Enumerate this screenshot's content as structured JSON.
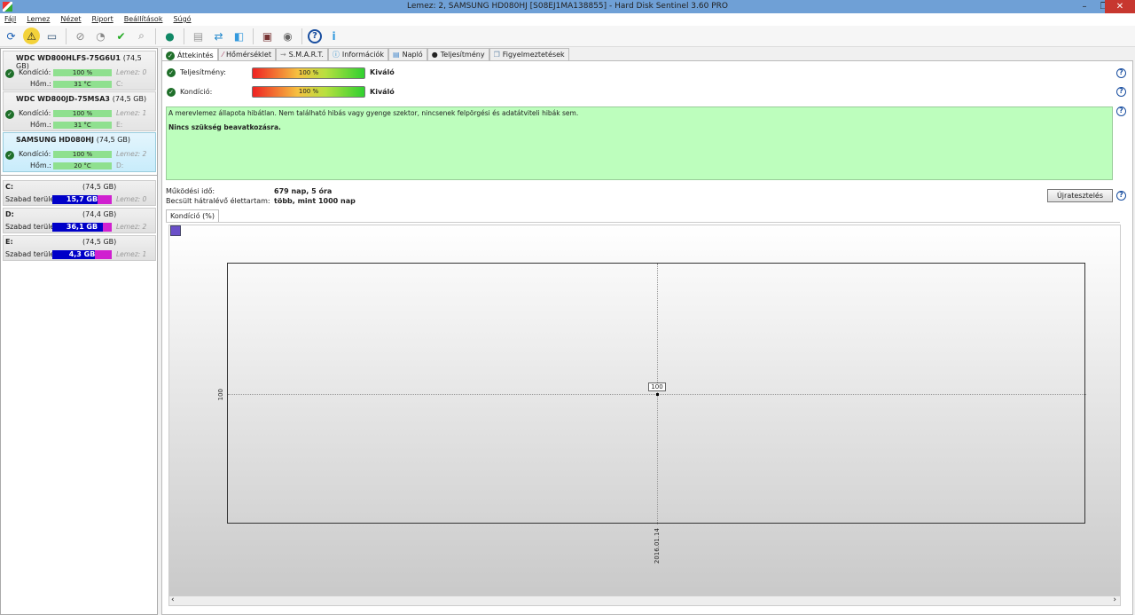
{
  "window": {
    "title": "Lemez: 2, SAMSUNG HD080HJ [S08EJ1MA138855]  -  Hard Disk Sentinel 3.60 PRO",
    "minimize": "–",
    "restore": "❐",
    "close": "✕"
  },
  "menu": [
    "Fájl",
    "Lemez",
    "Nézet",
    "Riport",
    "Beállítások",
    "Súgó"
  ],
  "toolbar_icons": [
    "refresh-icon",
    "alert-icon",
    "disk-info-icon",
    "test-icon",
    "test-timer-icon",
    "test-ok-icon",
    "test-search-icon",
    "web-icon",
    "report-icon",
    "sync-icon",
    "network-icon",
    "edit-icon",
    "sound-icon",
    "help-icon",
    "info-icon"
  ],
  "disks": [
    {
      "name": "WDC WD800HLFS-75G6U1",
      "size": "(74,5 GB)",
      "cond_label": "Kondíció:",
      "cond": "100 %",
      "temp_label": "Hőm.:",
      "temp": "31 °C",
      "lemez": "Lemez: 0",
      "drive": "C:"
    },
    {
      "name": "WDC WD800JD-75MSA3",
      "size": "(74,5 GB)",
      "cond_label": "Kondíció:",
      "cond": "100 %",
      "temp_label": "Hőm.:",
      "temp": "31 °C",
      "lemez": "Lemez: 1",
      "drive": "E:"
    },
    {
      "name": "SAMSUNG HD080HJ",
      "size": "(74,5 GB)",
      "cond_label": "Kondíció:",
      "cond": "100 %",
      "temp_label": "Hőm.:",
      "temp": "20 °C",
      "lemez": "Lemez: 2",
      "drive": "D:",
      "selected": true
    }
  ],
  "volumes": [
    {
      "letter": "C:",
      "size": "(74,5 GB)",
      "free_label": "Szabad terület",
      "free": "15,7 GB",
      "free_pct": 21,
      "lemez": "Lemez: 0"
    },
    {
      "letter": "D:",
      "size": "(74,4 GB)",
      "free_label": "Szabad terület",
      "free": "36,1 GB",
      "free_pct": 49,
      "lemez": "Lemez: 2"
    },
    {
      "letter": "E:",
      "size": "(74,5 GB)",
      "free_label": "Szabad terület",
      "free": "4,3 GB",
      "free_pct": 6,
      "lemez": "Lemez: 1"
    }
  ],
  "tabs": [
    "Áttekintés",
    "Hőmérséklet",
    "S.M.A.R.T.",
    "Információk",
    "Napló",
    "Teljesítmény",
    "Figyelmeztetések"
  ],
  "overview": {
    "perf_label": "Teljesítmény:",
    "perf_value": "100 %",
    "perf_rating": "Kiváló",
    "cond_label": "Kondíció:",
    "cond_value": "100 %",
    "cond_rating": "Kiváló",
    "status_text": "A merevlemez állapota hibátlan. Nem található hibás vagy gyenge szektor, nincsenek felpörgési és adatátviteli hibák sem.",
    "status_action": "Nincs szükség beavatkozásra.",
    "uptime_label": "Működési idő:",
    "uptime": "679 nap, 5 óra",
    "life_label": "Becsült hátralévő élettartam:",
    "life": "több, mint 1000 nap",
    "retest": "Újratesztelés",
    "help": "?"
  },
  "chart_tab": "Kondíció  (%)",
  "chart_data": {
    "type": "line",
    "x": [
      "2016.01.14"
    ],
    "values": [
      100
    ],
    "yticks": [
      "100"
    ],
    "data_labels": [
      "100"
    ],
    "grid": true
  }
}
